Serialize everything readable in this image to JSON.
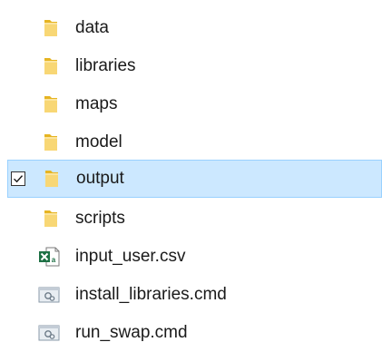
{
  "files": [
    {
      "name": "data",
      "type": "folder",
      "icon": "folder-icon"
    },
    {
      "name": "libraries",
      "type": "folder",
      "icon": "folder-icon"
    },
    {
      "name": "maps",
      "type": "folder",
      "icon": "folder-icon"
    },
    {
      "name": "model",
      "type": "folder",
      "icon": "folder-icon"
    },
    {
      "name": "output",
      "type": "folder",
      "icon": "folder-icon",
      "selected": true,
      "checked": true
    },
    {
      "name": "scripts",
      "type": "folder",
      "icon": "folder-icon"
    },
    {
      "name": "input_user.csv",
      "type": "csv",
      "icon": "excel-csv-icon"
    },
    {
      "name": "install_libraries.cmd",
      "type": "cmd",
      "icon": "cmd-script-icon"
    },
    {
      "name": "run_swap.cmd",
      "type": "cmd",
      "icon": "cmd-script-icon"
    }
  ],
  "colors": {
    "selection_background": "#cce8ff",
    "selection_border": "#99d1ff",
    "folder_yellow": "#f8d775",
    "excel_green": "#1d7044"
  }
}
